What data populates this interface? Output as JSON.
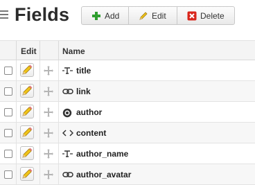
{
  "header": {
    "title": "Fields",
    "menu_icon": "menu-icon"
  },
  "toolbar": {
    "add_label": "Add",
    "edit_label": "Edit",
    "delete_label": "Delete",
    "add_icon": "plus-icon",
    "edit_icon": "pencil-icon",
    "delete_icon": "delete-x-icon"
  },
  "table": {
    "columns": [
      "",
      "Edit",
      "",
      "Name"
    ],
    "rows": [
      {
        "name": "title",
        "type_icon": "text-field-icon"
      },
      {
        "name": "link",
        "type_icon": "link-icon"
      },
      {
        "name": "author",
        "type_icon": "reference-icon"
      },
      {
        "name": "content",
        "type_icon": "code-icon"
      },
      {
        "name": "author_name",
        "type_icon": "text-field-icon"
      },
      {
        "name": "author_avatar",
        "type_icon": "link-icon"
      }
    ]
  },
  "colors": {
    "add_green": "#2f9e2f",
    "delete_red": "#d9261c",
    "pencil_yellow": "#f0c419"
  }
}
